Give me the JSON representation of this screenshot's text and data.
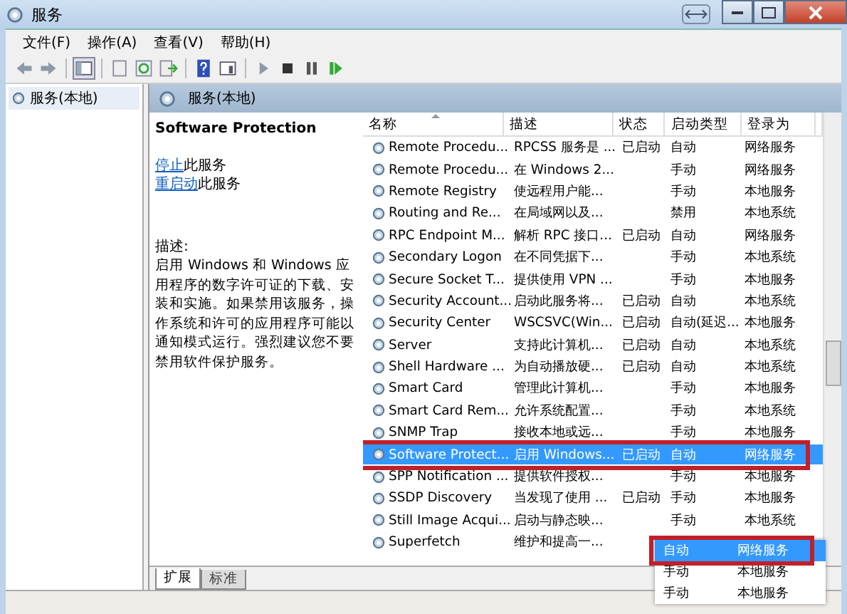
{
  "window": {
    "title": "服务"
  },
  "menu": [
    "文件(F)",
    "操作(A)",
    "查看(V)",
    "帮助(H)"
  ],
  "tree": {
    "items": [
      {
        "label": "服务(本地)",
        "selected": true
      }
    ]
  },
  "panel": {
    "title": "服务(本地)"
  },
  "details": {
    "service_name": "Software Protection",
    "actions": [
      {
        "link": "停止",
        "text": "此服务"
      },
      {
        "link": "重启动",
        "text": "此服务"
      }
    ],
    "description_label": "描述:",
    "description": "启用 Windows 和 Windows 应用程序的数字许可证的下载、安装和实施。如果禁用该服务，操作系统和许可的应用程序可能以通知模式运行。强烈建议您不要禁用软件保护服务。"
  },
  "table": {
    "columns": [
      "名称",
      "描述",
      "状态",
      "启动类型",
      "登录为"
    ],
    "rows": [
      {
        "name": "Remote Procedu...",
        "desc": "RPCSS 服务是 ...",
        "status": "已启动",
        "startup": "自动",
        "logon": "网络服务",
        "selected": false
      },
      {
        "name": "Remote Procedu...",
        "desc": "在 Windows 2...",
        "status": "",
        "startup": "手动",
        "logon": "网络服务",
        "selected": false
      },
      {
        "name": "Remote Registry",
        "desc": "使远程用户能...",
        "status": "",
        "startup": "手动",
        "logon": "本地服务",
        "selected": false
      },
      {
        "name": "Routing and Re...",
        "desc": "在局域网以及...",
        "status": "",
        "startup": "禁用",
        "logon": "本地系统",
        "selected": false
      },
      {
        "name": "RPC Endpoint M...",
        "desc": "解析 RPC 接口...",
        "status": "已启动",
        "startup": "自动",
        "logon": "网络服务",
        "selected": false
      },
      {
        "name": "Secondary Logon",
        "desc": "在不同凭据下...",
        "status": "",
        "startup": "手动",
        "logon": "本地系统",
        "selected": false
      },
      {
        "name": "Secure Socket T...",
        "desc": "提供使用 VPN ...",
        "status": "",
        "startup": "手动",
        "logon": "本地服务",
        "selected": false
      },
      {
        "name": "Security Account...",
        "desc": "启动此服务将...",
        "status": "已启动",
        "startup": "自动",
        "logon": "本地系统",
        "selected": false
      },
      {
        "name": "Security Center",
        "desc": "WSCSVC(Win...",
        "status": "已启动",
        "startup": "自动(延迟...",
        "logon": "本地服务",
        "selected": false
      },
      {
        "name": "Server",
        "desc": "支持此计算机...",
        "status": "已启动",
        "startup": "自动",
        "logon": "本地系统",
        "selected": false
      },
      {
        "name": "Shell Hardware ...",
        "desc": "为自动播放硬...",
        "status": "已启动",
        "startup": "自动",
        "logon": "本地系统",
        "selected": false
      },
      {
        "name": "Smart Card",
        "desc": "管理此计算机...",
        "status": "",
        "startup": "手动",
        "logon": "本地服务",
        "selected": false
      },
      {
        "name": "Smart Card Rem...",
        "desc": "允许系统配置...",
        "status": "",
        "startup": "手动",
        "logon": "本地系统",
        "selected": false
      },
      {
        "name": "SNMP Trap",
        "desc": "接收本地或远...",
        "status": "",
        "startup": "手动",
        "logon": "本地服务",
        "selected": false
      },
      {
        "name": "Software Protect...",
        "desc": "启用 Windows...",
        "status": "已启动",
        "startup": "自动",
        "logon": "网络服务",
        "selected": true
      },
      {
        "name": "SPP Notification ...",
        "desc": "提供软件授权...",
        "status": "",
        "startup": "手动",
        "logon": "本地服务",
        "selected": false
      },
      {
        "name": "SSDP Discovery",
        "desc": "当发现了使用 ...",
        "status": "已启动",
        "startup": "手动",
        "logon": "本地服务",
        "selected": false
      },
      {
        "name": "Still Image Acqui...",
        "desc": "启动与静态映...",
        "status": "",
        "startup": "手动",
        "logon": "本地系统",
        "selected": false
      },
      {
        "name": "Superfetch",
        "desc": "维护和提高一...",
        "status": "",
        "startup": "",
        "logon": "",
        "selected": false
      }
    ]
  },
  "inset": {
    "rows": [
      {
        "startup": "自动",
        "logon": "网络服务",
        "selected": true
      },
      {
        "startup": "手动",
        "logon": "本地服务",
        "selected": false
      },
      {
        "startup": "手动",
        "logon": "本地服务",
        "selected": false
      }
    ]
  },
  "tabs": [
    {
      "label": "扩展",
      "selected": true
    },
    {
      "label": "标准",
      "selected": false
    }
  ]
}
